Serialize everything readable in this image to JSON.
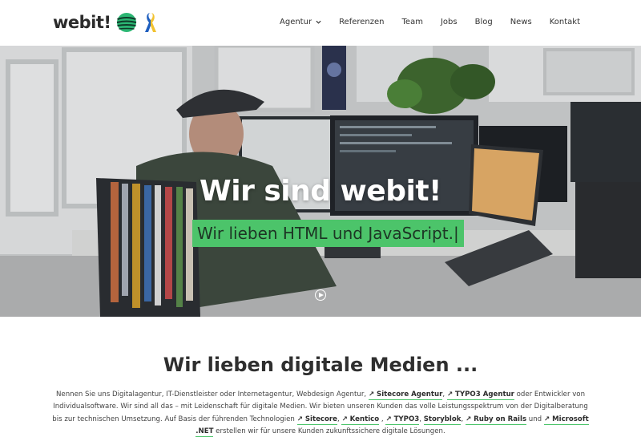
{
  "header": {
    "logo_text": "webit!",
    "nav": [
      {
        "label": "Agentur",
        "has_dropdown": true
      },
      {
        "label": "Referenzen"
      },
      {
        "label": "Team"
      },
      {
        "label": "Jobs"
      },
      {
        "label": "Blog"
      },
      {
        "label": "News"
      },
      {
        "label": "Kontakt"
      }
    ]
  },
  "hero": {
    "title": "Wir sind webit!",
    "subtitle": "Wir lieben HTML und JavaScript.|",
    "highlight_color": "#4cc46a"
  },
  "intro": {
    "headline": "Wir lieben digitale Medien ...",
    "t1": "Nennen Sie uns Digitalagentur, IT-Dienstleister oder Internetagentur, Webdesign Agentur, ",
    "l1": "Sitecore Agentur",
    "t2": ", ",
    "l2": "TYPO3 Agentur",
    "t3": " oder Entwickler von Individualsoftware. Wir sind all das – mit Leidenschaft für digitale Medien. Wir bieten unseren Kunden das volle Leistungsspektrum von der Digitalberatung bis zur technischen Umsetzung. Auf Basis der führenden Technologien ",
    "l3": "Sitecore",
    "t4": ", ",
    "l4": "Kentico",
    "t5": " , ",
    "l5": "TYPO3",
    "t6": ",  ",
    "l6": "Storyblok",
    "t7": ", ",
    "l7": "Ruby on Rails",
    "t8": " und ",
    "l8": "Microsoft .NET",
    "t9": " erstellen wir für unsere Kunden zukunftssichere digitale Lösungen.",
    "link_arrow": "↗"
  }
}
